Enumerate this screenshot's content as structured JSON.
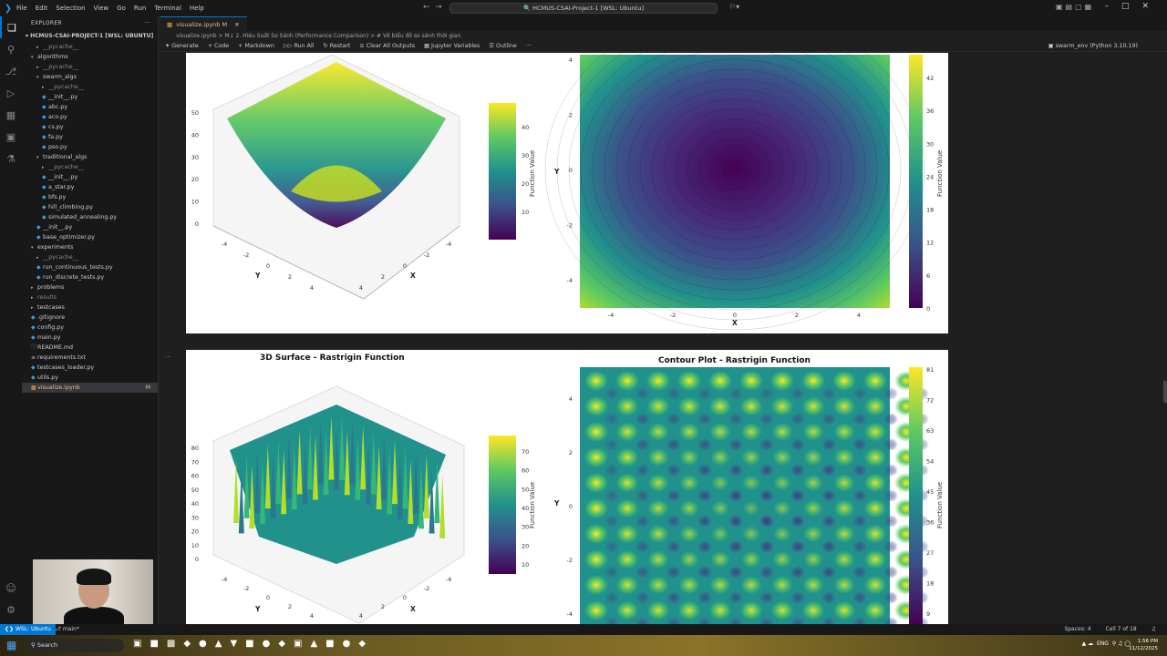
{
  "titlebar": {
    "menu": [
      "File",
      "Edit",
      "Selection",
      "View",
      "Go",
      "Run",
      "Terminal",
      "Help"
    ],
    "command_center": "HCMUS-CSAI-Project-1 [WSL: Ubuntu]"
  },
  "sidebar": {
    "title": "EXPLORER",
    "root": "HCMUS-CSAI-PROJECT-1 [WSL: UBUNTU]",
    "items": [
      {
        "label": "__pycache__",
        "depth": 1,
        "kind": "folder",
        "dim": true
      },
      {
        "label": "algorithms",
        "depth": 0,
        "kind": "folder-open"
      },
      {
        "label": "__pycache__",
        "depth": 1,
        "kind": "folder",
        "dim": true
      },
      {
        "label": "swarm_algs",
        "depth": 1,
        "kind": "folder-open"
      },
      {
        "label": "__pycache__",
        "depth": 2,
        "kind": "folder",
        "dim": true
      },
      {
        "label": "__init__.py",
        "depth": 2,
        "kind": "py"
      },
      {
        "label": "abc.py",
        "depth": 2,
        "kind": "py"
      },
      {
        "label": "aco.py",
        "depth": 2,
        "kind": "py"
      },
      {
        "label": "cs.py",
        "depth": 2,
        "kind": "py"
      },
      {
        "label": "fa.py",
        "depth": 2,
        "kind": "py"
      },
      {
        "label": "pso.py",
        "depth": 2,
        "kind": "py"
      },
      {
        "label": "traditional_algs",
        "depth": 1,
        "kind": "folder-open"
      },
      {
        "label": "__pycache__",
        "depth": 2,
        "kind": "folder",
        "dim": true
      },
      {
        "label": "__init__.py",
        "depth": 2,
        "kind": "py"
      },
      {
        "label": "a_star.py",
        "depth": 2,
        "kind": "py"
      },
      {
        "label": "bfs.py",
        "depth": 2,
        "kind": "py"
      },
      {
        "label": "hill_climbing.py",
        "depth": 2,
        "kind": "py"
      },
      {
        "label": "simulated_annealing.py",
        "depth": 2,
        "kind": "py"
      },
      {
        "label": "__init__.py",
        "depth": 1,
        "kind": "py"
      },
      {
        "label": "base_optimizer.py",
        "depth": 1,
        "kind": "py"
      },
      {
        "label": "experiments",
        "depth": 0,
        "kind": "folder-open"
      },
      {
        "label": "__pycache__",
        "depth": 1,
        "kind": "folder",
        "dim": true
      },
      {
        "label": "run_continuous_tests.py",
        "depth": 1,
        "kind": "py"
      },
      {
        "label": "run_discrete_tests.py",
        "depth": 1,
        "kind": "py"
      },
      {
        "label": "problems",
        "depth": 0,
        "kind": "folder"
      },
      {
        "label": "results",
        "depth": 0,
        "kind": "folder",
        "dim": true
      },
      {
        "label": "testcases",
        "depth": 0,
        "kind": "folder"
      },
      {
        "label": ".gitignore",
        "depth": 0,
        "kind": "file"
      },
      {
        "label": "config.py",
        "depth": 0,
        "kind": "py"
      },
      {
        "label": "main.py",
        "depth": 0,
        "kind": "py"
      },
      {
        "label": "README.md",
        "depth": 0,
        "kind": "md"
      },
      {
        "label": "requirements.txt",
        "depth": 0,
        "kind": "txt"
      },
      {
        "label": "testcases_loader.py",
        "depth": 0,
        "kind": "py"
      },
      {
        "label": "utils.py",
        "depth": 0,
        "kind": "py"
      },
      {
        "label": "visualize.ipynb",
        "depth": 0,
        "kind": "nb",
        "modified": true,
        "selected": true,
        "badge": "M"
      }
    ]
  },
  "editor": {
    "tab_label": "visualize.ipynb",
    "tab_badge": "M",
    "breadcrumb": "visualize.ipynb  >  M↓ 2. Hiệu Suất So Sánh (Performance Comparison)  >  # Vẽ biểu đồ so sánh thời gian",
    "toolbar": [
      "Generate",
      "+ Code",
      "+ Markdown",
      "Run All",
      "Restart",
      "Clear All Outputs",
      "Jupyter Variables",
      "Outline"
    ],
    "kernel": "swarm_env (Python 3.10.19)"
  },
  "plots": {
    "surface_yticks": [
      "0",
      "10",
      "20",
      "30",
      "40",
      "50"
    ],
    "cb1_ticks": [
      "10",
      "20",
      "30",
      "40"
    ],
    "contour1_yticks": [
      "4",
      "2",
      "0",
      "-2",
      "-4"
    ],
    "contour1_xticks": [
      "-4",
      "-2",
      "0",
      "2",
      "4"
    ],
    "cb2_ticks": [
      "42",
      "36",
      "30",
      "24",
      "18",
      "12",
      "6",
      "0"
    ],
    "cb_label": "Function Value",
    "x_label": "X",
    "y_label": "Y",
    "rastrigin_surface_title": "3D Surface - Rastrigin Function",
    "rastrigin_contour_title": "Contour Plot - Rastrigin Function",
    "surface2_zticks": [
      "0",
      "10",
      "20",
      "30",
      "40",
      "50",
      "60",
      "70",
      "80"
    ],
    "cb3_ticks": [
      "70",
      "60",
      "50",
      "40",
      "30",
      "20",
      "10"
    ],
    "cb4_ticks": [
      "81",
      "72",
      "63",
      "54",
      "45",
      "36",
      "27",
      "18",
      "9"
    ],
    "surface_axis_ticks": [
      "-4",
      "-2",
      "0",
      "2",
      "4"
    ]
  },
  "statusbar": {
    "remote": "WSL: Ubuntu",
    "branch": "main*",
    "spaces": "Spaces: 4",
    "cell": "Cell 7 of 18"
  },
  "taskbar": {
    "search_placeholder": "Search",
    "time": "1:56 PM",
    "date": "11/12/2025",
    "lang": "ENG"
  },
  "colors": {
    "accent": "#0078d4",
    "modified": "#e2c08d",
    "viridis_low": "#440154",
    "viridis_high": "#fde725"
  }
}
